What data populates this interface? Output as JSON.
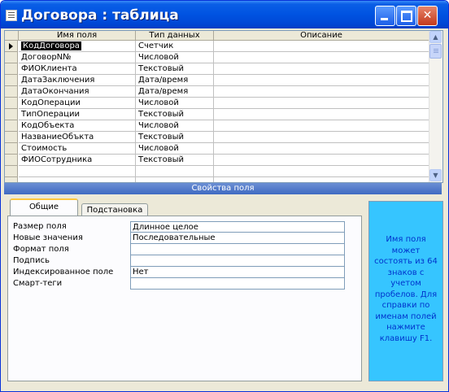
{
  "window": {
    "title": "Договора : таблица"
  },
  "grid": {
    "columns": [
      "Имя поля",
      "Тип данных",
      "Описание"
    ],
    "rows": [
      {
        "name": "КодДоговора",
        "type": "Счетчик"
      },
      {
        "name": "ДоговорN№",
        "type": "Числовой"
      },
      {
        "name": "ФИОКлиента",
        "type": "Текстовый"
      },
      {
        "name": "ДатаЗаключения",
        "type": "Дата/время"
      },
      {
        "name": "ДатаОкончания",
        "type": "Дата/время"
      },
      {
        "name": "КодОперации",
        "type": "Числовой"
      },
      {
        "name": "ТипОперации",
        "type": "Текстовый"
      },
      {
        "name": "КодОбъекта",
        "type": "Числовой"
      },
      {
        "name": "НазваниеОбъкта",
        "type": "Текстовый"
      },
      {
        "name": "Стоимость",
        "type": "Числовой"
      },
      {
        "name": "ФИОСотрудника",
        "type": "Текстовый"
      }
    ]
  },
  "properties": {
    "header": "Свойства поля",
    "tabs": [
      "Общие",
      "Подстановка"
    ],
    "rows": [
      {
        "label": "Размер поля",
        "value": "Длинное целое"
      },
      {
        "label": "Новые значения",
        "value": "Последовательные"
      },
      {
        "label": "Формат поля",
        "value": ""
      },
      {
        "label": "Подпись",
        "value": ""
      },
      {
        "label": "Индексированное поле",
        "value": "Нет"
      },
      {
        "label": "Смарт-теги",
        "value": ""
      }
    ]
  },
  "help": {
    "text": "Имя поля может состоять из 64 знаков с учетом пробелов. Для справки по именам полей нажмите клавишу F1."
  }
}
